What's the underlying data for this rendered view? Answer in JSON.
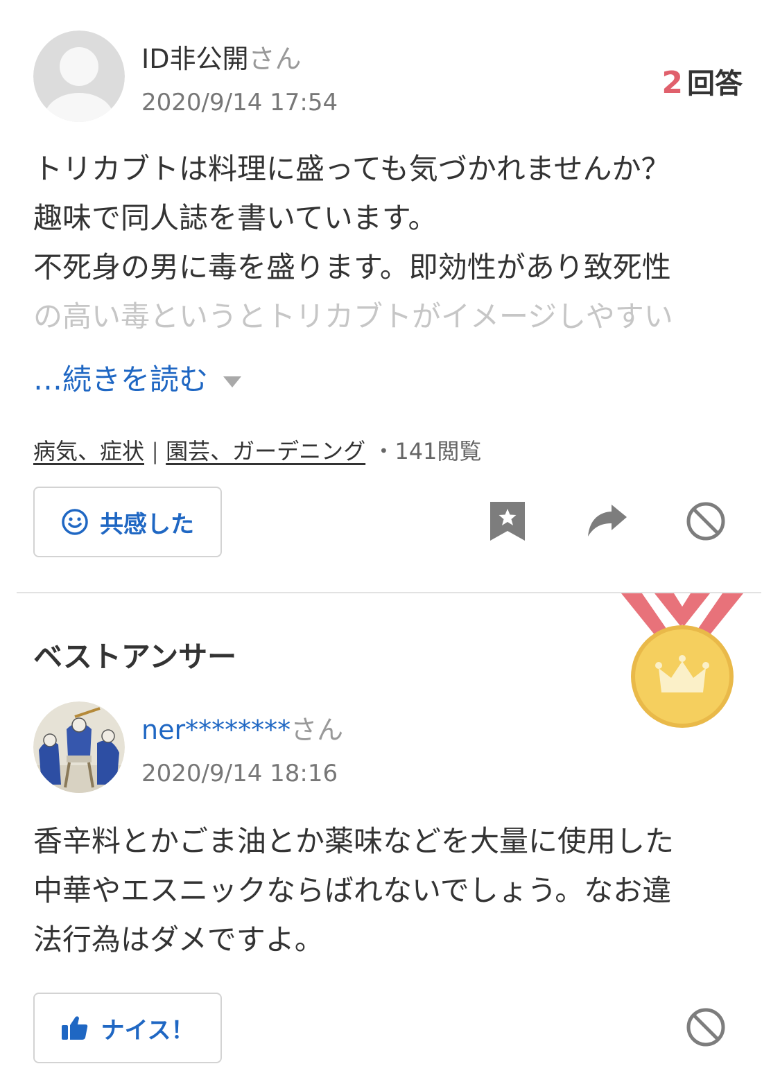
{
  "question": {
    "user_name": "ID非公開",
    "honorific": "さん",
    "timestamp": "2020/9/14 17:54",
    "answer_count": "2",
    "answer_count_label": "回答",
    "lines": [
      "トリカブトは料理に盛っても気づかれませんか？",
      "趣味で同人誌を書いています。",
      "不死身の男に毒を盛ります。即効性があり致死性",
      "の高い毒というとトリカブトがイメージしやすい"
    ],
    "read_more": "…続きを読む",
    "categories": [
      "病気、症状",
      "園芸、ガーデニング"
    ],
    "category_separator": "|",
    "views": "・141閲覧",
    "empathy_label": "共感した"
  },
  "best_answer": {
    "heading": "ベストアンサー",
    "user_name": "ner********",
    "honorific": "さん",
    "timestamp": "2020/9/14 18:16",
    "lines": [
      "香辛料とかごま油とか薬味などを大量に使用した",
      "中華やエスニックならばれないでしょう。なお違",
      "法行為はダメですよ。"
    ],
    "nice_label": "ナイス！"
  },
  "icons": {
    "avatar_default": "default-avatar-icon",
    "smile": "smile-icon",
    "bookmark": "bookmark-star-icon",
    "share": "share-arrow-icon",
    "block": "block-icon",
    "medal": "gold-medal-crown-icon",
    "thumb": "thumbs-up-icon"
  },
  "colors": {
    "accent_blue": "#1f67c3",
    "answer_count_red": "#e0606c",
    "medal_gold": "#f5cf5e",
    "ribbon_red": "#e8727a"
  }
}
